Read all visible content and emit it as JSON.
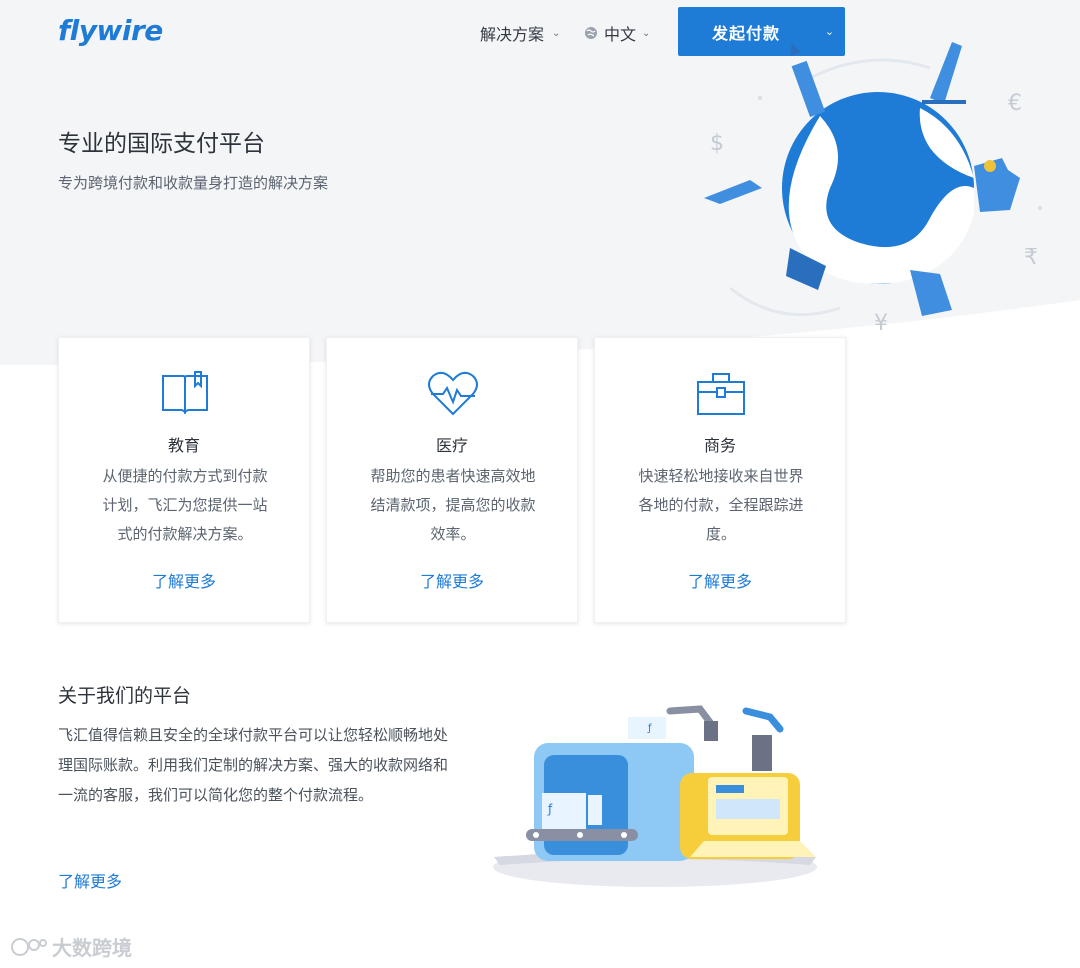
{
  "header": {
    "logo": "flywire",
    "nav_solutions": "解决方案",
    "nav_language": "中文",
    "cta_label": "发起付款"
  },
  "hero": {
    "title": "专业的国际支付平台",
    "subtitle": "专为跨境付款和收款量身打造的解决方案",
    "currency_symbols": [
      "$",
      "€",
      "₹",
      "¥"
    ]
  },
  "cards": [
    {
      "icon": "book-icon",
      "title": "教育",
      "desc_lines": [
        "从便捷的付款方式到付款",
        "计划，飞汇为您提供一站",
        "式的付款解决方案。"
      ],
      "link": "了解更多"
    },
    {
      "icon": "heart-pulse-icon",
      "title": "医疗",
      "desc_lines": [
        "帮助您的患者快速高效地",
        "结清款项，提高您的收款",
        "效率。"
      ],
      "link": "了解更多"
    },
    {
      "icon": "briefcase-icon",
      "title": "商务",
      "desc_lines": [
        "快速轻松地接收来自世界",
        "各地的付款，全程跟踪进",
        "度。"
      ],
      "link": "了解更多"
    }
  ],
  "about": {
    "title": "关于我们的平台",
    "body": "飞汇值得信赖且安全的全球付款平台可以让您轻松顺畅地处理国际账款。利用我们定制的解决方案、强大的收款网络和一流的客服，我们可以简化您的整个付款流程。",
    "link": "了解更多"
  },
  "watermark": "大数跨境",
  "colors": {
    "brand_blue": "#1e7bd6",
    "hero_bg": "#f4f5f7",
    "text_dark": "#2d333b"
  }
}
